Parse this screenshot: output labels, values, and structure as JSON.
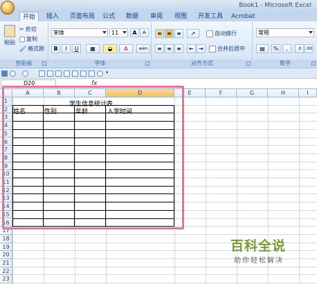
{
  "window": {
    "title": "Book1 - Microsoft Excel"
  },
  "tabs": [
    "开始",
    "插入",
    "页面布局",
    "公式",
    "数据",
    "审阅",
    "视图",
    "开发工具",
    "Acrobat"
  ],
  "clipboard": {
    "paste": "粘贴",
    "cut": "剪切",
    "copy": "复制",
    "format_painter": "格式刷",
    "label": "剪贴板"
  },
  "font": {
    "name": "宋体",
    "size": "11",
    "bold": "B",
    "italic": "I",
    "underline": "U",
    "grow": "A",
    "shrink": "A",
    "label": "字体",
    "color_letter": "A",
    "phonetic": "wén"
  },
  "alignment": {
    "wrap_text": "自动换行",
    "merge_center": "合并后居中",
    "label": "对齐方式"
  },
  "number": {
    "format": "常规",
    "percent": "%",
    "comma": ",",
    "label": "数字"
  },
  "formula_bar": {
    "name_box": "D20",
    "fx": "fx"
  },
  "columns": [
    "A",
    "B",
    "C",
    "D",
    "E",
    "F",
    "G",
    "H",
    "I"
  ],
  "rows": [
    "1",
    "2",
    "3",
    "4",
    "5",
    "6",
    "7",
    "8",
    "9",
    "10",
    "11",
    "12",
    "13",
    "14",
    "15",
    "16",
    "17",
    "18",
    "19",
    "20",
    "21",
    "22",
    "23"
  ],
  "sheet": {
    "table_title": "学生信息统计表",
    "headers": [
      "姓名",
      "性别",
      "年龄",
      "入学时间"
    ]
  },
  "watermark": {
    "title": "百科全说",
    "subtitle": "助你轻松解决"
  },
  "colors": {
    "accent": "#ec7090",
    "ribbon": "#dce8f6",
    "selected_col": "#f1c15f"
  }
}
